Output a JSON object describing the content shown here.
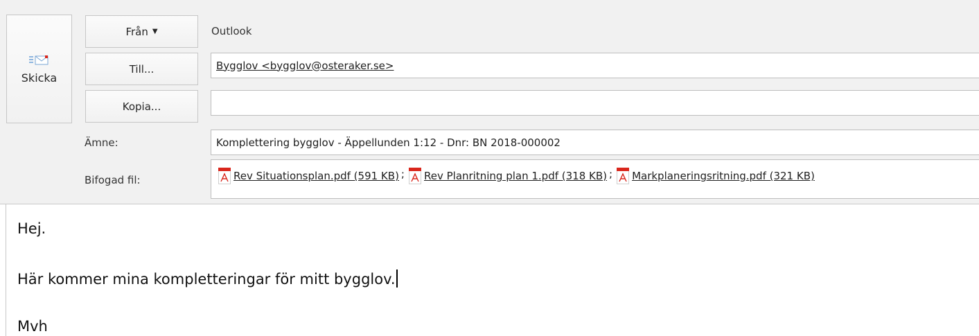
{
  "compose": {
    "send_label": "Skicka",
    "from_label": "Från",
    "from_value": "Outlook",
    "to_label": "Till...",
    "to_value": "Bygglov <bygglov@osteraker.se>",
    "cc_label": "Kopia...",
    "cc_value": "",
    "subject_label": "Ämne:",
    "subject_value": "Komplettering bygglov - Äppellunden 1:12 - Dnr: BN 2018-000002",
    "attach_label": "Bifogad fil:",
    "attachments": [
      {
        "name": "Rev Situationsplan.pdf (591 KB)",
        "icon": "pdf-icon"
      },
      {
        "name": "Rev Planritning plan 1.pdf (318 KB)",
        "icon": "pdf-icon"
      },
      {
        "name": "Markplaneringsritning.pdf (321 KB)",
        "icon": "pdf-icon"
      }
    ],
    "attachment_separator": ";"
  },
  "message": {
    "line1": "Hej.",
    "line2": "Här kommer mina kompletteringar för mitt bygglov.",
    "line3": "Mvh"
  },
  "colors": {
    "header_bg": "#f1f1f1",
    "pdf_red": "#d9261c"
  }
}
